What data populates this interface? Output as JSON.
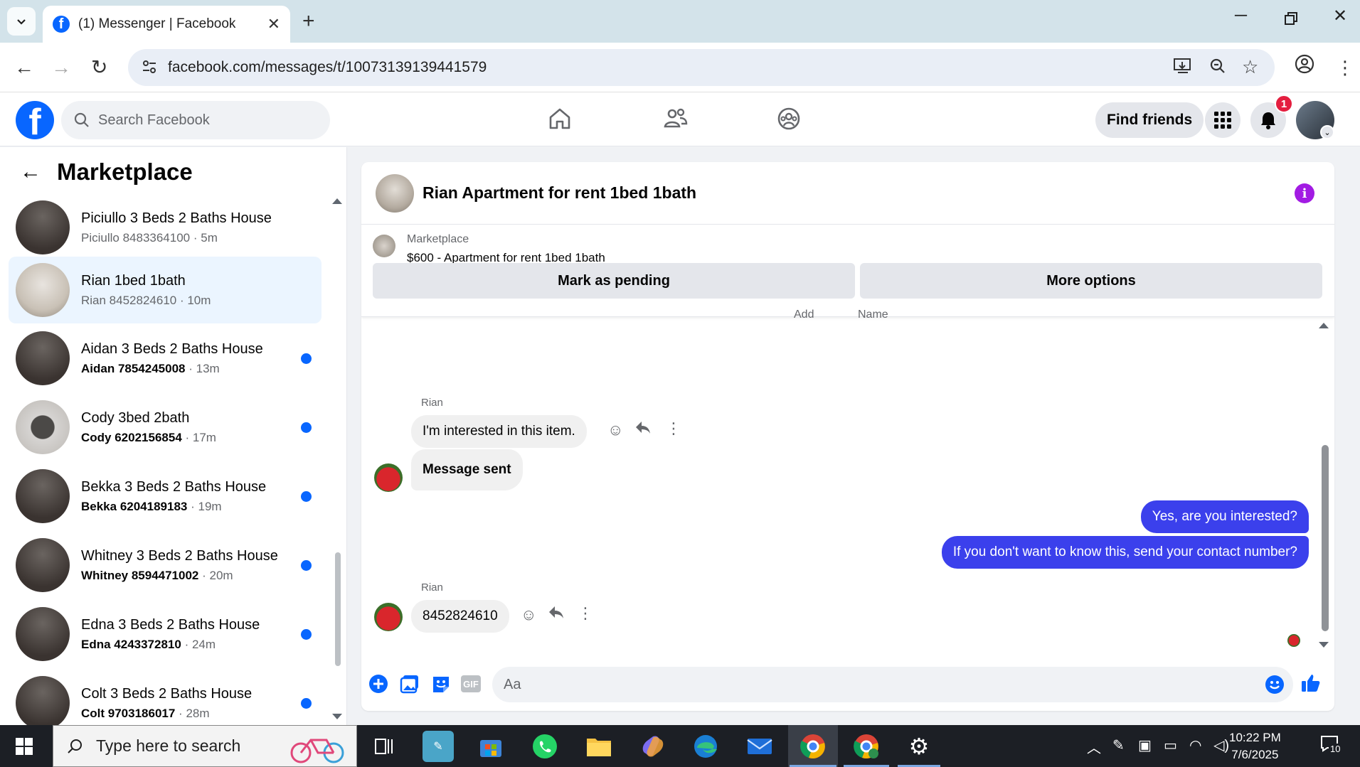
{
  "browser": {
    "tab_title": "(1) Messenger | Facebook",
    "url": "facebook.com/messages/t/10073139139441579"
  },
  "fb": {
    "search_placeholder": "Search Facebook",
    "find_friends": "Find friends",
    "notification_count": "1"
  },
  "left": {
    "title": "Marketplace",
    "conversations": [
      {
        "name": "Piciullo 3 Beds 2 Baths House",
        "who": "Piciullo 8483364100",
        "time": "5m",
        "unread": false,
        "active": false
      },
      {
        "name": "Rian 1bed 1bath",
        "who": "Rian 8452824610",
        "time": "10m",
        "unread": false,
        "active": true
      },
      {
        "name": "Aidan 3 Beds 2 Baths House",
        "who": "Aidan 7854245008",
        "time": "13m",
        "unread": true,
        "active": false
      },
      {
        "name": "Cody 3bed 2bath",
        "who": "Cody 6202156854",
        "time": "17m",
        "unread": true,
        "active": false
      },
      {
        "name": "Bekka 3 Beds 2 Baths House",
        "who": "Bekka 6204189183",
        "time": "19m",
        "unread": true,
        "active": false
      },
      {
        "name": "Whitney 3 Beds 2 Baths House",
        "who": "Whitney 8594471002",
        "time": "20m",
        "unread": true,
        "active": false
      },
      {
        "name": "Edna 3 Beds 2 Baths House",
        "who": "Edna 4243372810",
        "time": "24m",
        "unread": true,
        "active": false
      },
      {
        "name": "Colt 3 Beds 2 Baths House",
        "who": "Colt 9703186017",
        "time": "28m",
        "unread": true,
        "active": false
      }
    ]
  },
  "chat": {
    "title": "Rian Apartment for rent 1bed 1bath",
    "listing_label": "Marketplace",
    "listing_price": "$600 - Apartment for rent 1bed 1bath",
    "mark_pending": "Mark as pending",
    "more_options": "More options",
    "cut_text_1": "Add",
    "cut_text_2": "Name",
    "messages": [
      {
        "sender": "Rian",
        "text": "I'm interested in this item."
      },
      {
        "text": "Message sent"
      },
      {
        "text": "Yes, are you interested?"
      },
      {
        "text": "If you don't want to know this, send your contact number?"
      },
      {
        "sender": "Rian",
        "text": "8452824610"
      }
    ],
    "composer_placeholder": "Aa",
    "gif_label": "GIF"
  },
  "taskbar": {
    "search_placeholder": "Type here to search",
    "time": "10:22 PM",
    "date": "7/6/2025",
    "notif_count": "10"
  },
  "colors": {
    "fb_blue": "#0866ff",
    "outgoing_bubble": "#3b40ec",
    "info_purple": "#a21be3",
    "unread_dot": "#0866ff"
  }
}
